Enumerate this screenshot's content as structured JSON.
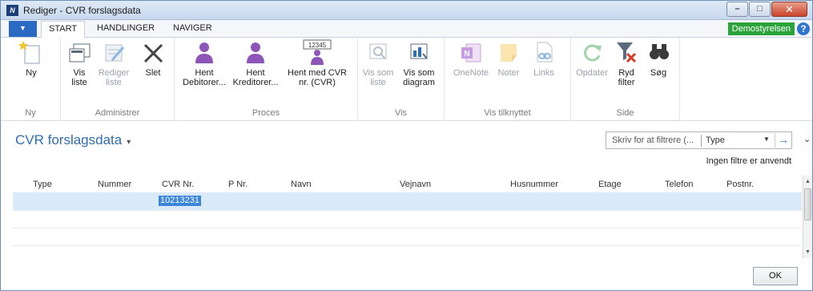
{
  "window": {
    "title": "Rediger - CVR forslagsdata",
    "app_icon_text": "N"
  },
  "tabs": {
    "file_glyph": "▼",
    "items": [
      "START",
      "HANDLINGER",
      "NAVIGER"
    ],
    "company": "Demostyrelsen",
    "help": "?"
  },
  "ribbon": {
    "groups": {
      "ny": {
        "label": "Ny",
        "buttons": [
          "Ny"
        ]
      },
      "administrer": {
        "label": "Administrer",
        "buttons": [
          [
            "Vis",
            "liste"
          ],
          [
            "Rediger",
            "liste"
          ],
          [
            "Slet"
          ]
        ]
      },
      "proces": {
        "label": "Proces",
        "buttons": [
          [
            "Hent",
            "Debitorer..."
          ],
          [
            "Hent",
            "Kreditorer..."
          ],
          [
            "Hent med CVR",
            "nr. (CVR)"
          ]
        ]
      },
      "vis": {
        "label": "Vis",
        "buttons": [
          [
            "Vis som",
            "liste"
          ],
          [
            "Vis som",
            "diagram"
          ]
        ]
      },
      "vis_tilknyttet": {
        "label": "Vis tilknyttet",
        "buttons": [
          "OneNote",
          "Noter",
          "Links"
        ]
      },
      "side": {
        "label": "Side",
        "buttons": [
          "Opdater",
          [
            "Ryd",
            "filter"
          ],
          "Søg"
        ]
      }
    },
    "icon_number_text": "12345"
  },
  "page": {
    "title": "CVR forslagsdata",
    "title_chevron": "▾",
    "filter_placeholder": "Skriv for at filtrere (...",
    "filter_field": "Type",
    "filter_dropdown": "▼",
    "filter_go": "→",
    "collapse": "⌄",
    "no_filter_text": "Ingen filtre er anvendt"
  },
  "grid": {
    "columns": [
      "Type",
      "Nummer",
      "CVR Nr.",
      "P Nr.",
      "Navn",
      "Vejnavn",
      "Husnummer",
      "Etage",
      "Telefon",
      "Postnr."
    ],
    "rows": [
      {
        "cvr_nr": "10213231"
      }
    ]
  },
  "footer": {
    "ok_label": "OK"
  },
  "colors": {
    "accent": "#2f6db4",
    "company_badge": "#2aa33b",
    "selected_row": "#daeaf8",
    "selected_cell": "#3b86d8"
  }
}
